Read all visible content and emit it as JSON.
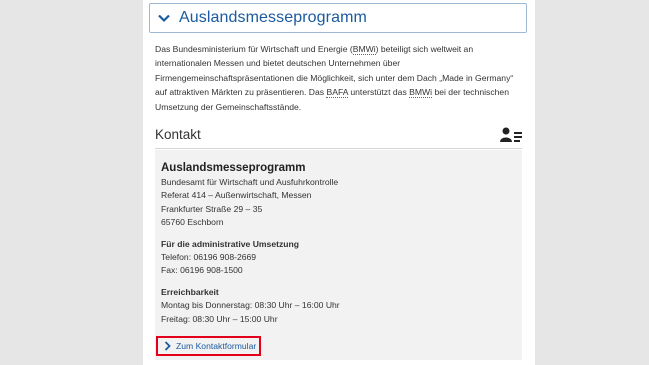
{
  "accordion": {
    "title": "Auslandsmesseprogramm",
    "icon": "chevron-down-icon"
  },
  "intro": {
    "p1": "Das Bundesministerium für Wirtschaft und Energie (",
    "abbr1": "BMWi",
    "p2": ") beteiligt sich weltweit an internationalen Messen und bietet deutschen Unternehmen über Firmengemeinschaftspräsentationen die Möglichkeit, sich unter dem Dach „Made in Germany“ auf attraktiven Märkten zu präsentieren. Das ",
    "abbr2": "BAFA",
    "p3": " unterstützt das ",
    "abbr3": "BMWi",
    "p4": " bei der technischen Umsetzung der Gemeinschaftsstände."
  },
  "kontakt": {
    "title": "Kontakt",
    "icon": "contact-list-icon",
    "card": {
      "name": "Auslandsmesseprogramm",
      "address": [
        "Bundesamt für Wirtschaft und Ausfuhrkontrolle",
        "Referat 414 – Außenwirtschaft, Messen",
        "Frankfurter Straße 29 – 35",
        "65760 Eschborn"
      ],
      "admin_heading": "Für die administrative Umsetzung",
      "phone": "Telefon: 06196 908-2669",
      "fax": "Fax: 06196 908-1500",
      "hours_heading": "Erreichbarkeit",
      "hours": [
        "Montag bis Donnerstag: 08:30 Uhr – 16:00 Uhr",
        "Freitag: 08:30 Uhr – 15:00 Uhr"
      ]
    },
    "link": {
      "label": "Zum Kontaktformular",
      "icon": "chevron-right-icon",
      "highlight_color": "#e2001a"
    }
  },
  "colors": {
    "accent": "#1a5aa0",
    "border": "#9cb9d6",
    "card_bg": "#f2f2f2"
  }
}
